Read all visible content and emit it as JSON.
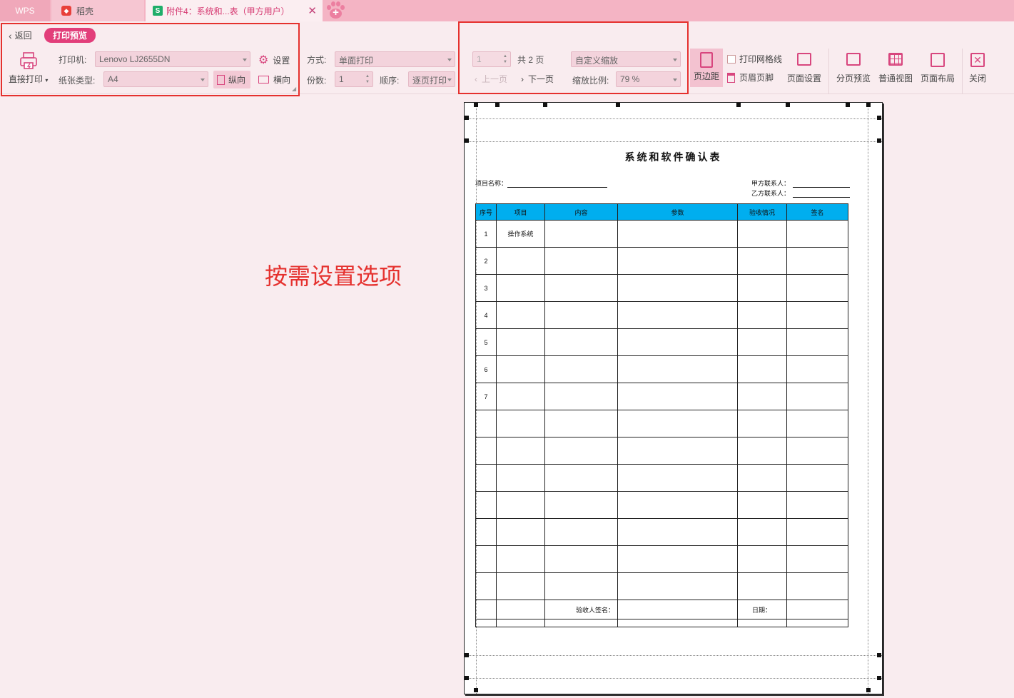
{
  "tabs": {
    "wps": "WPS",
    "daoke": "稻壳",
    "document": "附件4：系统和...表（甲方用户）"
  },
  "ribbon": {
    "back": "返回",
    "mode_badge": "打印预览",
    "direct_print": "直接打印",
    "printer_label": "打印机:",
    "printer_value": "Lenovo LJ2655DN",
    "settings": "设置",
    "paper_label": "纸张类型:",
    "paper_value": "A4",
    "portrait": "纵向",
    "landscape": "横向",
    "mode_label": "方式:",
    "mode_value": "单面打印",
    "copies_label": "份数:",
    "copies_value": "1",
    "order_label": "顺序:",
    "order_value": "逐页打印",
    "page_value": "1",
    "total_pages": "共 2 页",
    "prev_page": "上一页",
    "next_page": "下一页",
    "zoom_mode_value": "自定义缩放",
    "zoom_label": "缩放比例:",
    "zoom_value": "79 %",
    "margins": "页边距",
    "print_gridlines": "打印网格线",
    "header_footer": "页眉页脚",
    "page_setup": "页面设置",
    "page_break_preview": "分页预览",
    "normal_view": "普通视图",
    "page_layout": "页面布局",
    "close": "关闭"
  },
  "annotation": "按需设置选项",
  "document": {
    "title": "系统和软件确认表",
    "project_name_label": "项目名称：",
    "party_a_label": "甲方联系人：",
    "party_b_label": "乙方联系人：",
    "headers": [
      "序号",
      "项目",
      "内容",
      "参数",
      "验收情况",
      "签名"
    ],
    "rows": [
      [
        "1",
        "操作系统",
        "",
        "",
        "",
        ""
      ],
      [
        "2",
        "",
        "",
        "",
        "",
        ""
      ],
      [
        "3",
        "",
        "",
        "",
        "",
        ""
      ],
      [
        "4",
        "",
        "",
        "",
        "",
        ""
      ],
      [
        "5",
        "",
        "",
        "",
        "",
        ""
      ],
      [
        "6",
        "",
        "",
        "",
        "",
        ""
      ],
      [
        "7",
        "",
        "",
        "",
        "",
        ""
      ],
      [
        "",
        "",
        "",
        "",
        "",
        ""
      ],
      [
        "",
        "",
        "",
        "",
        "",
        ""
      ],
      [
        "",
        "",
        "",
        "",
        "",
        ""
      ],
      [
        "",
        "",
        "",
        "",
        "",
        ""
      ],
      [
        "",
        "",
        "",
        "",
        "",
        ""
      ],
      [
        "",
        "",
        "",
        "",
        "",
        ""
      ],
      [
        "",
        "",
        "",
        "",
        "",
        ""
      ]
    ],
    "signature_label": "验收人签名：",
    "date_label": "日期："
  }
}
